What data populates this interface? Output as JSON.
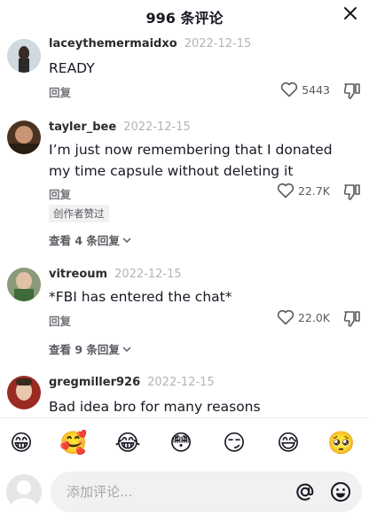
{
  "header": {
    "title": "996 条评论",
    "close_icon": "close-icon"
  },
  "comments": [
    {
      "username": "laceythemermaidxo",
      "date": "2022-12-15",
      "text": "READY",
      "reply_label": "回复",
      "likes": "5443"
    },
    {
      "username": "tayler_bee",
      "date": "2022-12-15",
      "text": "I’m just now remembering that I donated my time capsule without deleting it",
      "reply_label": "回复",
      "likes": "22.7K",
      "creator_badge": "创作者赞过",
      "view_replies": "查看 4 条回复"
    },
    {
      "username": "vitreoum",
      "date": "2022-12-15",
      "text": "*FBI has entered the chat*",
      "reply_label": "回复",
      "likes": "22.0K",
      "view_replies": "查看 9 条回复"
    },
    {
      "username": "gregmiller926",
      "date": "2022-12-15",
      "text": "Bad idea bro for many reasons"
    }
  ],
  "emoji_bar": [
    "😁",
    "🥰",
    "😂",
    "😳",
    "😏",
    "😅",
    "🥺"
  ],
  "input": {
    "placeholder": "添加评论..."
  },
  "colors": {
    "text": "#161823",
    "muted": "#73747a",
    "date": "#b4b4b9"
  }
}
